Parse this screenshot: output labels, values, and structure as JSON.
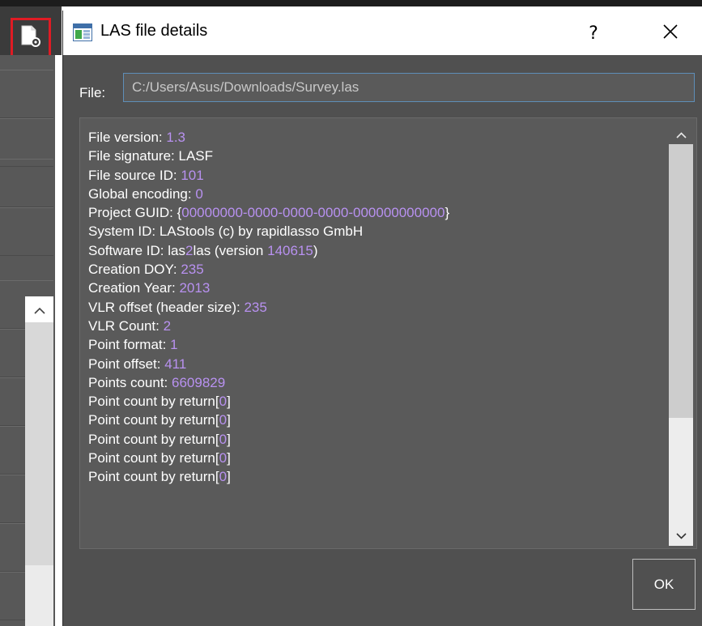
{
  "dialog": {
    "title": "LAS file details",
    "help_label": "?",
    "file_label": "File:",
    "file_path": "C:/Users/Asus/Downloads/Survey.las",
    "ok_label": "OK",
    "lines": [
      {
        "label": "File version: ",
        "value": "1.3",
        "suffix": ""
      },
      {
        "label": "File signature: LASF",
        "value": "",
        "suffix": ""
      },
      {
        "label": "File source ID: ",
        "value": "101",
        "suffix": ""
      },
      {
        "label": "Global encoding: ",
        "value": "0",
        "suffix": ""
      },
      {
        "label": "Project GUID: {",
        "value": "00000000-0000-0000-0000-000000000000",
        "suffix": "}"
      },
      {
        "label": "System ID: LAStools (c) by rapidlasso GmbH",
        "value": "",
        "suffix": ""
      },
      {
        "label": "Software ID: las",
        "value": "2",
        "suffix": "las (version ",
        "value2": "140615",
        "suffix2": ")"
      },
      {
        "label": "Creation DOY: ",
        "value": "235",
        "suffix": ""
      },
      {
        "label": "Creation Year: ",
        "value": "2013",
        "suffix": ""
      },
      {
        "label": "VLR offset (header size): ",
        "value": "235",
        "suffix": ""
      },
      {
        "label": "VLR Count: ",
        "value": "2",
        "suffix": ""
      },
      {
        "label": "Point format: ",
        "value": "1",
        "suffix": ""
      },
      {
        "label": "Point offset: ",
        "value": "411",
        "suffix": ""
      },
      {
        "label": "Points count: ",
        "value": "6609829",
        "suffix": ""
      },
      {
        "label": "Point count by return[",
        "value": "0",
        "suffix": "]"
      },
      {
        "label": "Point count by return[",
        "value": "0",
        "suffix": "]"
      },
      {
        "label": "Point count by return[",
        "value": "0",
        "suffix": "]"
      },
      {
        "label": "Point count by return[",
        "value": "0",
        "suffix": "]"
      },
      {
        "label": "Point count by return[",
        "value": "0",
        "suffix": "]"
      }
    ]
  },
  "icons": {
    "tool_button": "las-details-icon",
    "dialog_icon": "window-icon",
    "close": "close-icon",
    "scroll_up": "chevron-up-icon",
    "scroll_down": "chevron-down-icon"
  },
  "colors": {
    "value_accent": "#b891f0",
    "dialog_bg": "#505050",
    "highlight_border": "#e01b24"
  }
}
